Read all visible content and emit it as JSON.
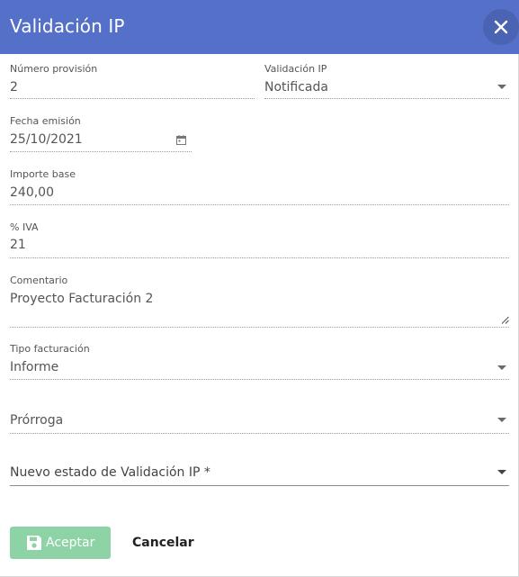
{
  "dialog": {
    "title": "Validación IP"
  },
  "form": {
    "numero_provision": {
      "label": "Número provisión",
      "value": "2"
    },
    "validacion_ip": {
      "label": "Validación IP",
      "value": "Notificada"
    },
    "fecha_emision": {
      "label": "Fecha emisión",
      "value": "25/10/2021"
    },
    "importe_base": {
      "label": "Importe base",
      "value": "240,00"
    },
    "iva": {
      "label": "% IVA",
      "value": "21"
    },
    "comentario": {
      "label": "Comentario",
      "value": "Proyecto Facturación 2"
    },
    "tipo_facturacion": {
      "label": "Tipo facturación",
      "value": "Informe"
    },
    "prorroga": {
      "value": "Prórroga"
    },
    "nuevo_estado": {
      "value": "Nuevo estado de Validación IP *"
    }
  },
  "actions": {
    "accept_label": "Aceptar",
    "cancel_label": "Cancelar"
  },
  "colors": {
    "header": "#5470c9",
    "accept_button": "#8ed3a6"
  },
  "icons": {
    "close": "close-icon",
    "calendar": "calendar-icon",
    "save": "save-icon",
    "dropdown": "chevron-down-icon",
    "resize": "resize-handle-icon"
  }
}
